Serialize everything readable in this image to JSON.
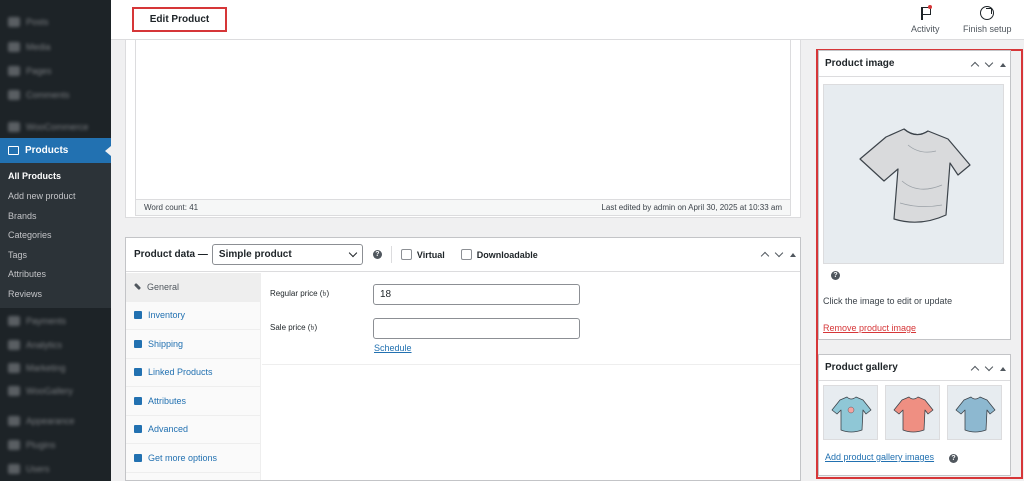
{
  "sidebar": {
    "blurred_top": [
      "Posts",
      "Media",
      "Pages",
      "Comments",
      "WooCommerce"
    ],
    "active": "Products",
    "submenu": [
      "All Products",
      "Add new product",
      "Brands",
      "Categories",
      "Tags",
      "Attributes",
      "Reviews"
    ],
    "blurred_bottom": [
      "Payments",
      "Analytics",
      "Marketing",
      "WooGallery",
      "Appearance",
      "Plugins",
      "Users"
    ]
  },
  "header": {
    "title": "Edit Product",
    "activity_label": "Activity",
    "finish_setup_label": "Finish setup"
  },
  "editor": {
    "word_count": "Word count: 41",
    "last_edited": "Last edited by admin on April 30, 2025 at 10:33 am"
  },
  "product_data": {
    "title": "Product data —",
    "type_selected": "Simple product",
    "virtual_label": "Virtual",
    "downloadable_label": "Downloadable",
    "tabs": [
      "General",
      "Inventory",
      "Shipping",
      "Linked Products",
      "Attributes",
      "Advanced",
      "Get more options"
    ],
    "regular_price_label": "Regular price (৳)",
    "regular_price_value": "18",
    "sale_price_label": "Sale price (৳)",
    "sale_price_value": "",
    "schedule_label": "Schedule"
  },
  "product_image": {
    "title": "Product image",
    "hint": "Click the image to edit or update",
    "remove_label": "Remove product image"
  },
  "product_gallery": {
    "title": "Product gallery",
    "add_label": "Add product gallery images",
    "thumb_colors": [
      "#8fc7d6",
      "#ef8f82",
      "#8db8d0"
    ]
  },
  "colors": {
    "accent": "#2271b1",
    "highlight_border": "#d63638",
    "sidebar_bg": "#1d2327"
  }
}
